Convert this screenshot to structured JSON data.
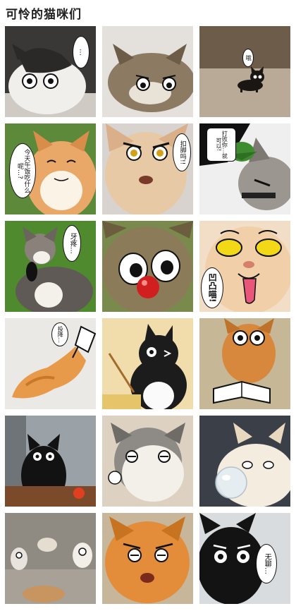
{
  "page": {
    "title": "可怜的猫咪们"
  },
  "tiles": [
    {
      "id": "cat-1",
      "bubble": "…"
    },
    {
      "id": "cat-2",
      "bubble": ""
    },
    {
      "id": "cat-3",
      "bubble": "哦"
    },
    {
      "id": "cat-4",
      "bubble": "今天午饭吃什么呢…?"
    },
    {
      "id": "cat-5",
      "bubble": "扣脚吗!!"
    },
    {
      "id": "cat-6",
      "bubble": "打败你…就可以!"
    },
    {
      "id": "cat-7",
      "bubble": "牙疼…"
    },
    {
      "id": "cat-8",
      "bubble": ""
    },
    {
      "id": "cat-9",
      "bubble": "凹凸喵!"
    },
    {
      "id": "cat-10",
      "bubble": "投降…"
    },
    {
      "id": "cat-11",
      "bubble": ""
    },
    {
      "id": "cat-12",
      "bubble": ""
    },
    {
      "id": "cat-13",
      "bubble": ""
    },
    {
      "id": "cat-14",
      "bubble": ""
    },
    {
      "id": "cat-15",
      "bubble": ""
    },
    {
      "id": "cat-16",
      "bubble": ""
    },
    {
      "id": "cat-17",
      "bubble": ""
    },
    {
      "id": "cat-18",
      "bubble": "无聊…"
    }
  ]
}
